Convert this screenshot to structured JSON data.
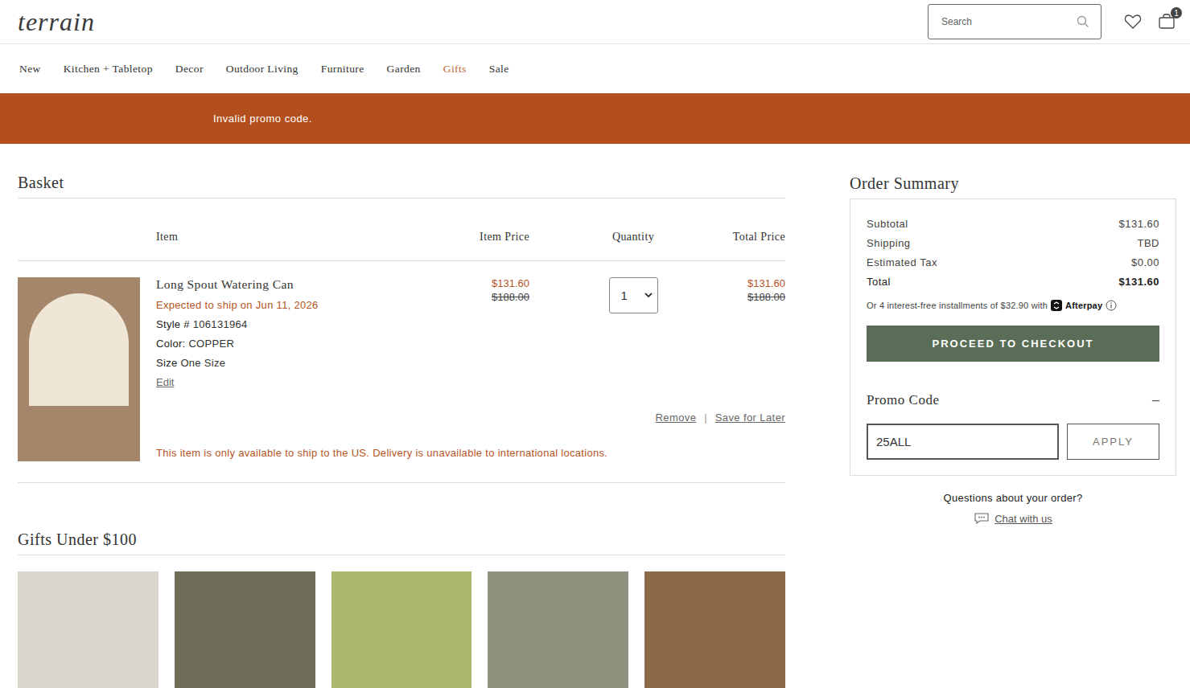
{
  "header": {
    "logo": "terrain",
    "search": {
      "placeholder": "Search",
      "value": ""
    },
    "basket_count": "1"
  },
  "nav": [
    {
      "label": "New",
      "selected": false
    },
    {
      "label": "Kitchen + Tabletop",
      "selected": false
    },
    {
      "label": "Decor",
      "selected": false
    },
    {
      "label": "Outdoor Living",
      "selected": false
    },
    {
      "label": "Furniture",
      "selected": false
    },
    {
      "label": "Garden",
      "selected": false
    },
    {
      "label": "Gifts",
      "selected": true
    },
    {
      "label": "Sale",
      "selected": false
    }
  ],
  "alert": "Invalid promo code.",
  "basket": {
    "title": "Basket",
    "columns": [
      "Item",
      "Item Price",
      "Quantity",
      "Total Price"
    ],
    "items": [
      {
        "name": "Long Spout Watering Can",
        "ship_note": "Expected to ship on Jun 11, 2026",
        "details": [
          {
            "label": "Style #",
            "value": "106131964"
          },
          {
            "label": "Color:",
            "value": "COPPER"
          },
          {
            "label": "Size",
            "value": "One Size"
          }
        ],
        "edit": "Edit",
        "price": "$131.60",
        "original_price": "$188.00",
        "quantity": "1",
        "total": "$131.60",
        "original_total": "$188.00",
        "actions": [
          "Remove",
          "Save for Later"
        ],
        "separator": "|",
        "notice": "This item is only available to ship to the US. Delivery is unavailable to international locations."
      }
    ]
  },
  "recommendations": {
    "title": "Gifts Under $100"
  },
  "summary": {
    "title": "Order Summary",
    "rows": [
      {
        "label": "Subtotal",
        "value": "$131.60",
        "emphasis": false
      },
      {
        "label": "Shipping",
        "value": "TBD",
        "emphasis": false
      },
      {
        "label": "Estimated Tax",
        "value": "$0.00",
        "emphasis": false
      },
      {
        "label": "Total",
        "value": "$131.60",
        "emphasis": true
      }
    ],
    "installments": {
      "text": "Or 4 interest-free installments of $32.90 with",
      "provider": "Afterpay"
    },
    "checkout": "PROCEED TO CHECKOUT",
    "promo": {
      "title": "Promo Code",
      "expanded": true,
      "toggle": "–",
      "value": "25ALL",
      "button": "APPLY"
    }
  },
  "help": {
    "question": "Questions about your order?",
    "link": "Chat with us"
  }
}
